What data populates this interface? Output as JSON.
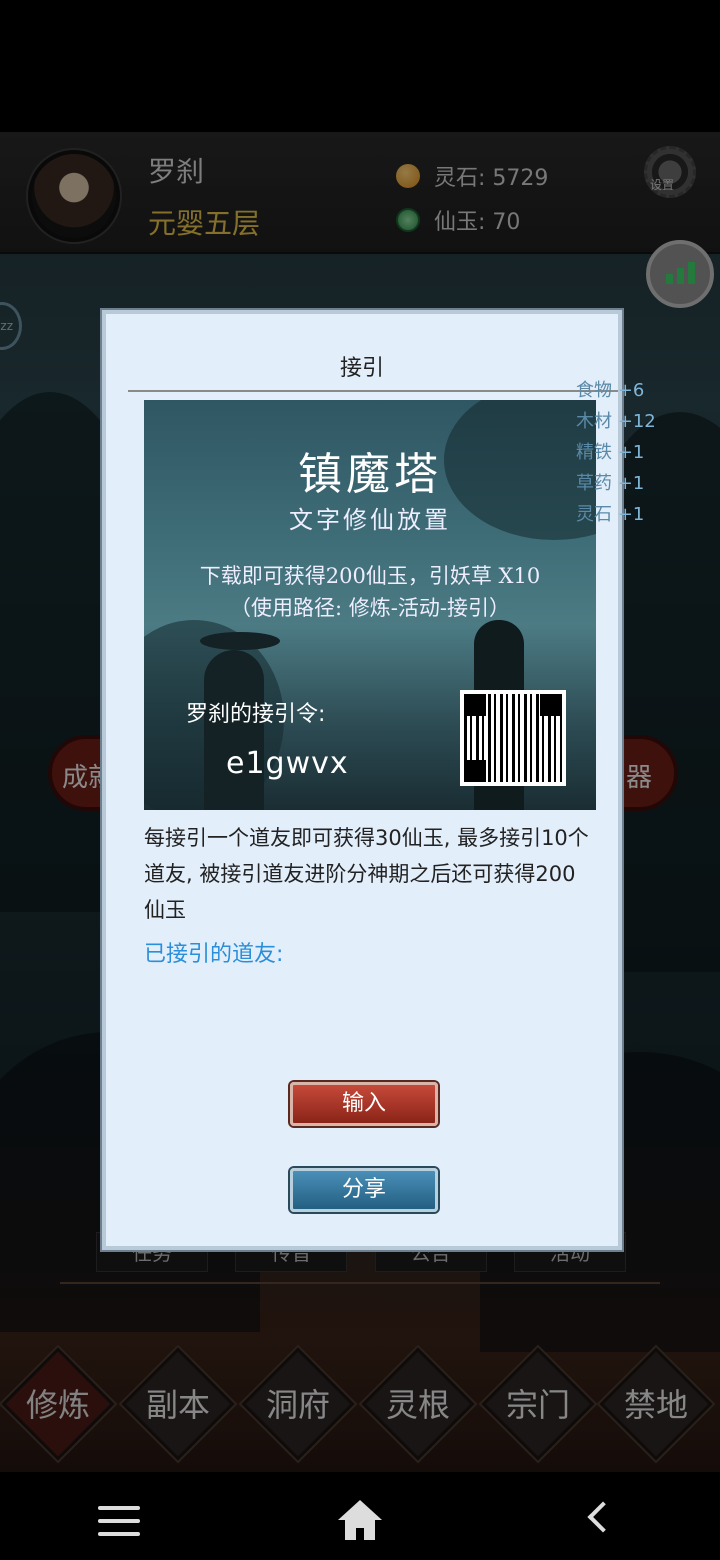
{
  "header": {
    "player_name": "罗刹",
    "realm": "元婴五层",
    "spirit_stone_label": "灵石: 5729",
    "immortal_jade_label": "仙玉: 70",
    "settings_label": "设置"
  },
  "side_buttons": {
    "left_label": "成就",
    "right_label": "器"
  },
  "float_log": {
    "items": [
      {
        "label": "食物",
        "value": "+6"
      },
      {
        "label": "木材",
        "value": "+12"
      },
      {
        "label": "精铁",
        "value": "+1"
      },
      {
        "label": "草药",
        "value": "+1"
      },
      {
        "label": "灵石",
        "value": "+1"
      }
    ]
  },
  "tabs": [
    "任务",
    "传音",
    "公告",
    "活动"
  ],
  "bottom_nav": [
    "修炼",
    "副本",
    "洞府",
    "灵根",
    "宗门",
    "禁地"
  ],
  "dialog": {
    "title": "接引",
    "promo": {
      "title": "镇魔塔",
      "subtitle": "文字修仙放置",
      "line1": "下载即可获得200仙玉，引妖草 X10",
      "line2": "（使用路径: 修炼-活动-接引）",
      "code_label": "罗刹的接引令:",
      "code_value": "e1gwvx"
    },
    "description": "每接引一个道友即可获得30仙玉, 最多接引10个道友, 被接引道友进阶分神期之后还可获得200仙玉",
    "invited_label": "已接引的道友:",
    "input_button": "输入",
    "share_button": "分享"
  },
  "colors": {
    "accent_gold": "#e6c24a",
    "link_blue": "#2a8fd8",
    "button_red": "#a8352a",
    "button_blue": "#3478a0"
  }
}
